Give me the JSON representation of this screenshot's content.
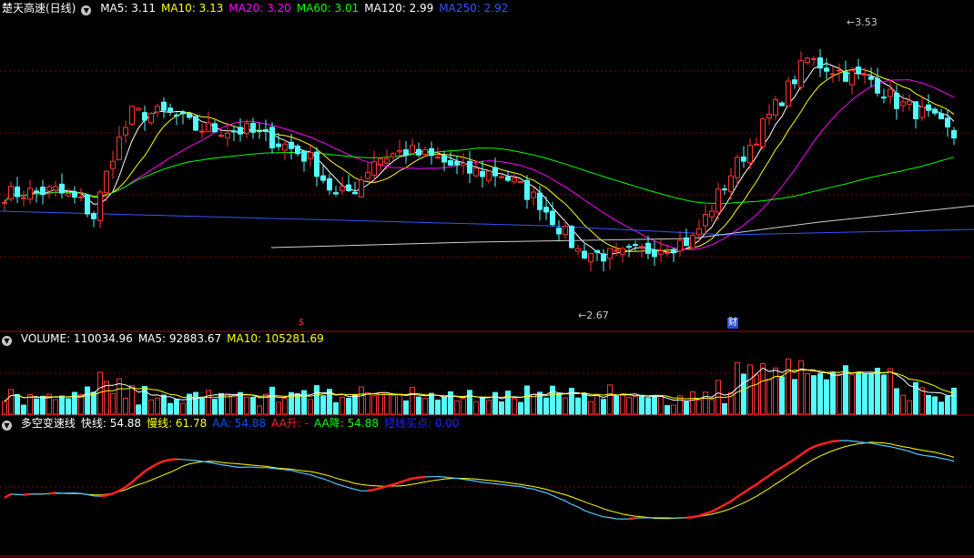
{
  "main_header": {
    "title": "楚天高速(日线)",
    "items": [
      {
        "label": "MA5: 3.11",
        "color": "#ffffff"
      },
      {
        "label": "MA10: 3.13",
        "color": "#ffff00"
      },
      {
        "label": "MA20: 3.20",
        "color": "#ff00ff"
      },
      {
        "label": "MA60: 3.01",
        "color": "#00ff00"
      },
      {
        "label": "MA120: 2.99",
        "color": "#ffffff"
      },
      {
        "label": "MA250: 2.92",
        "color": "#3355ff"
      }
    ]
  },
  "volume_header": {
    "items": [
      {
        "label": "VOLUME: 110034.96",
        "color": "#ffffff"
      },
      {
        "label": "MA5: 92883.67",
        "color": "#ffffff"
      },
      {
        "label": "MA10: 105281.69",
        "color": "#ffff00"
      }
    ]
  },
  "indicator_header": {
    "items": [
      {
        "label": "多空变速线",
        "color": "#ffffff"
      },
      {
        "label": "快线: 54.88",
        "color": "#ffffff"
      },
      {
        "label": "慢线: 61.78",
        "color": "#ffff00"
      },
      {
        "label": "AA: 54.88",
        "color": "#0055ff"
      },
      {
        "label": "AA升: -",
        "color": "#ff2020"
      },
      {
        "label": "AA降: 54.88",
        "color": "#00ff00"
      },
      {
        "label": "短线买点: 0.00",
        "color": "#2222ff"
      }
    ]
  },
  "markers": {
    "high_label": "3.53",
    "low_label": "2.67",
    "event_s": "$",
    "event_cai": "财"
  },
  "colors": {
    "up": "#ff3333",
    "down": "#54fcfc",
    "grid": "#8b0000",
    "separator": "#b00000"
  },
  "chart_data": [
    {
      "type": "candlestick",
      "title": "楚天高速(日线)",
      "ylim": [
        2.55,
        3.6
      ],
      "high": 3.53,
      "low": 2.67,
      "series": [
        {
          "name": "MA5",
          "values": [
            3.11
          ]
        },
        {
          "name": "MA10",
          "values": [
            3.13
          ]
        },
        {
          "name": "MA20",
          "values": [
            3.2
          ]
        },
        {
          "name": "MA60",
          "values": [
            3.01
          ]
        },
        {
          "name": "MA120",
          "values": [
            2.99
          ]
        },
        {
          "name": "MA250",
          "values": [
            2.92
          ]
        }
      ]
    },
    {
      "type": "bar",
      "title": "VOLUME",
      "series": [
        {
          "name": "VOLUME",
          "values": [
            110034.96
          ]
        },
        {
          "name": "MA5",
          "values": [
            92883.67
          ]
        },
        {
          "name": "MA10",
          "values": [
            105281.69
          ]
        }
      ]
    },
    {
      "type": "line",
      "title": "多空变速线",
      "series": [
        {
          "name": "快线",
          "values": [
            54.88
          ]
        },
        {
          "name": "慢线",
          "values": [
            61.78
          ]
        },
        {
          "name": "AA",
          "values": [
            54.88
          ]
        },
        {
          "name": "AA降",
          "values": [
            54.88
          ]
        },
        {
          "name": "短线买点",
          "values": [
            0.0
          ]
        }
      ]
    }
  ]
}
